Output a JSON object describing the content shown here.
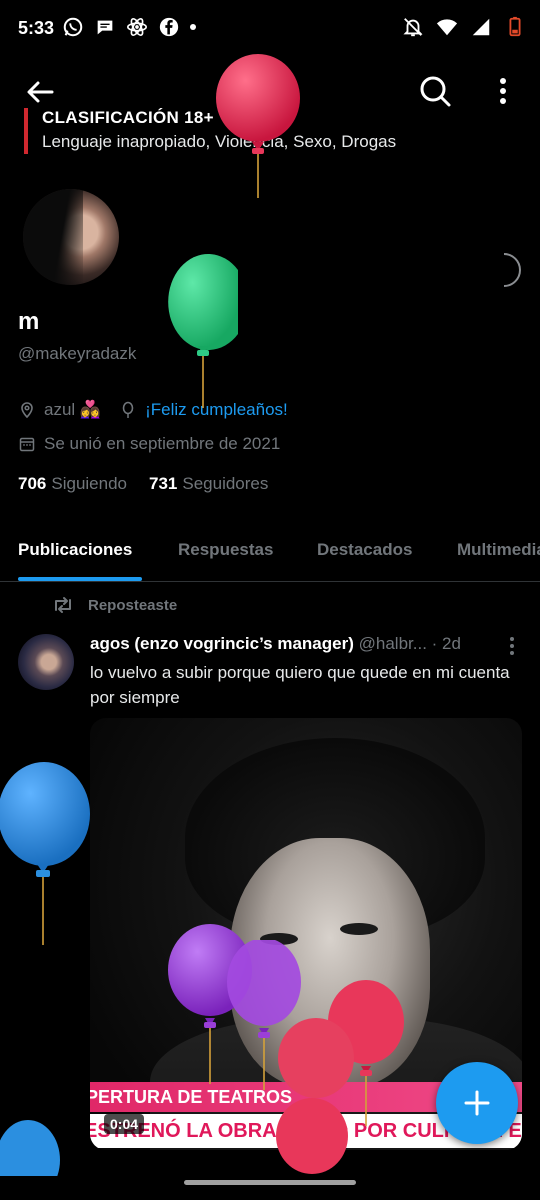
{
  "status_bar": {
    "time": "5:33",
    "left_icons": [
      "whatsapp-icon",
      "chat-bubble-icon",
      "react-icon",
      "facebook-icon",
      "dot-icon"
    ],
    "right_icons": [
      "muted-bell-icon",
      "wifi-icon",
      "signal-icon",
      "battery-low-icon"
    ]
  },
  "top_bar": {
    "back_icon": "arrow-left-icon",
    "search_icon": "search-icon",
    "more_icon": "more-vertical-icon"
  },
  "content_rating": {
    "title": "CLASIFICACIÓN 18+",
    "description": "Lenguaje inapropiado, Violencia, Sexo, Drogas",
    "bar_color": "#d0282f"
  },
  "profile": {
    "name": "m",
    "handle": "@makeyradazk",
    "location": "azul 👩‍❤️‍👩",
    "birthday": "¡Feliz cumpleaños!",
    "joined": "Se unió en septiembre de 2021",
    "following_count": "706",
    "following_label": "Siguiendo",
    "followers_count": "731",
    "followers_label": "Seguidores"
  },
  "tabs": [
    {
      "label": "Publicaciones",
      "active": true
    },
    {
      "label": "Respuestas",
      "active": false
    },
    {
      "label": "Destacados",
      "active": false
    },
    {
      "label": "Multimedia",
      "active": false
    }
  ],
  "post": {
    "repost_label": "Reposteaste",
    "author": "agos (enzo vogrincic’s manager)",
    "handle": "@halbr...",
    "time": "· 2d",
    "text": "lo vuelvo a subir porque quiero que quede en mi cuenta por siempre",
    "media": {
      "ticker_top": "PERTURA DE TEATROS",
      "ticker_bottom": "ESTRENÓ LA OBRA \"TODO POR CULPA DE ELLA\" EN",
      "duration": "0:04"
    }
  },
  "fab": {
    "icon": "plus-icon"
  },
  "colors": {
    "accent": "#1d9bf0",
    "text_secondary": "#71767b",
    "background": "#000000",
    "balloon_red": "#e8375a",
    "balloon_green": "#2ecb86",
    "balloon_blue": "#2b8fe0",
    "balloon_purple": "#9b3fd8"
  }
}
